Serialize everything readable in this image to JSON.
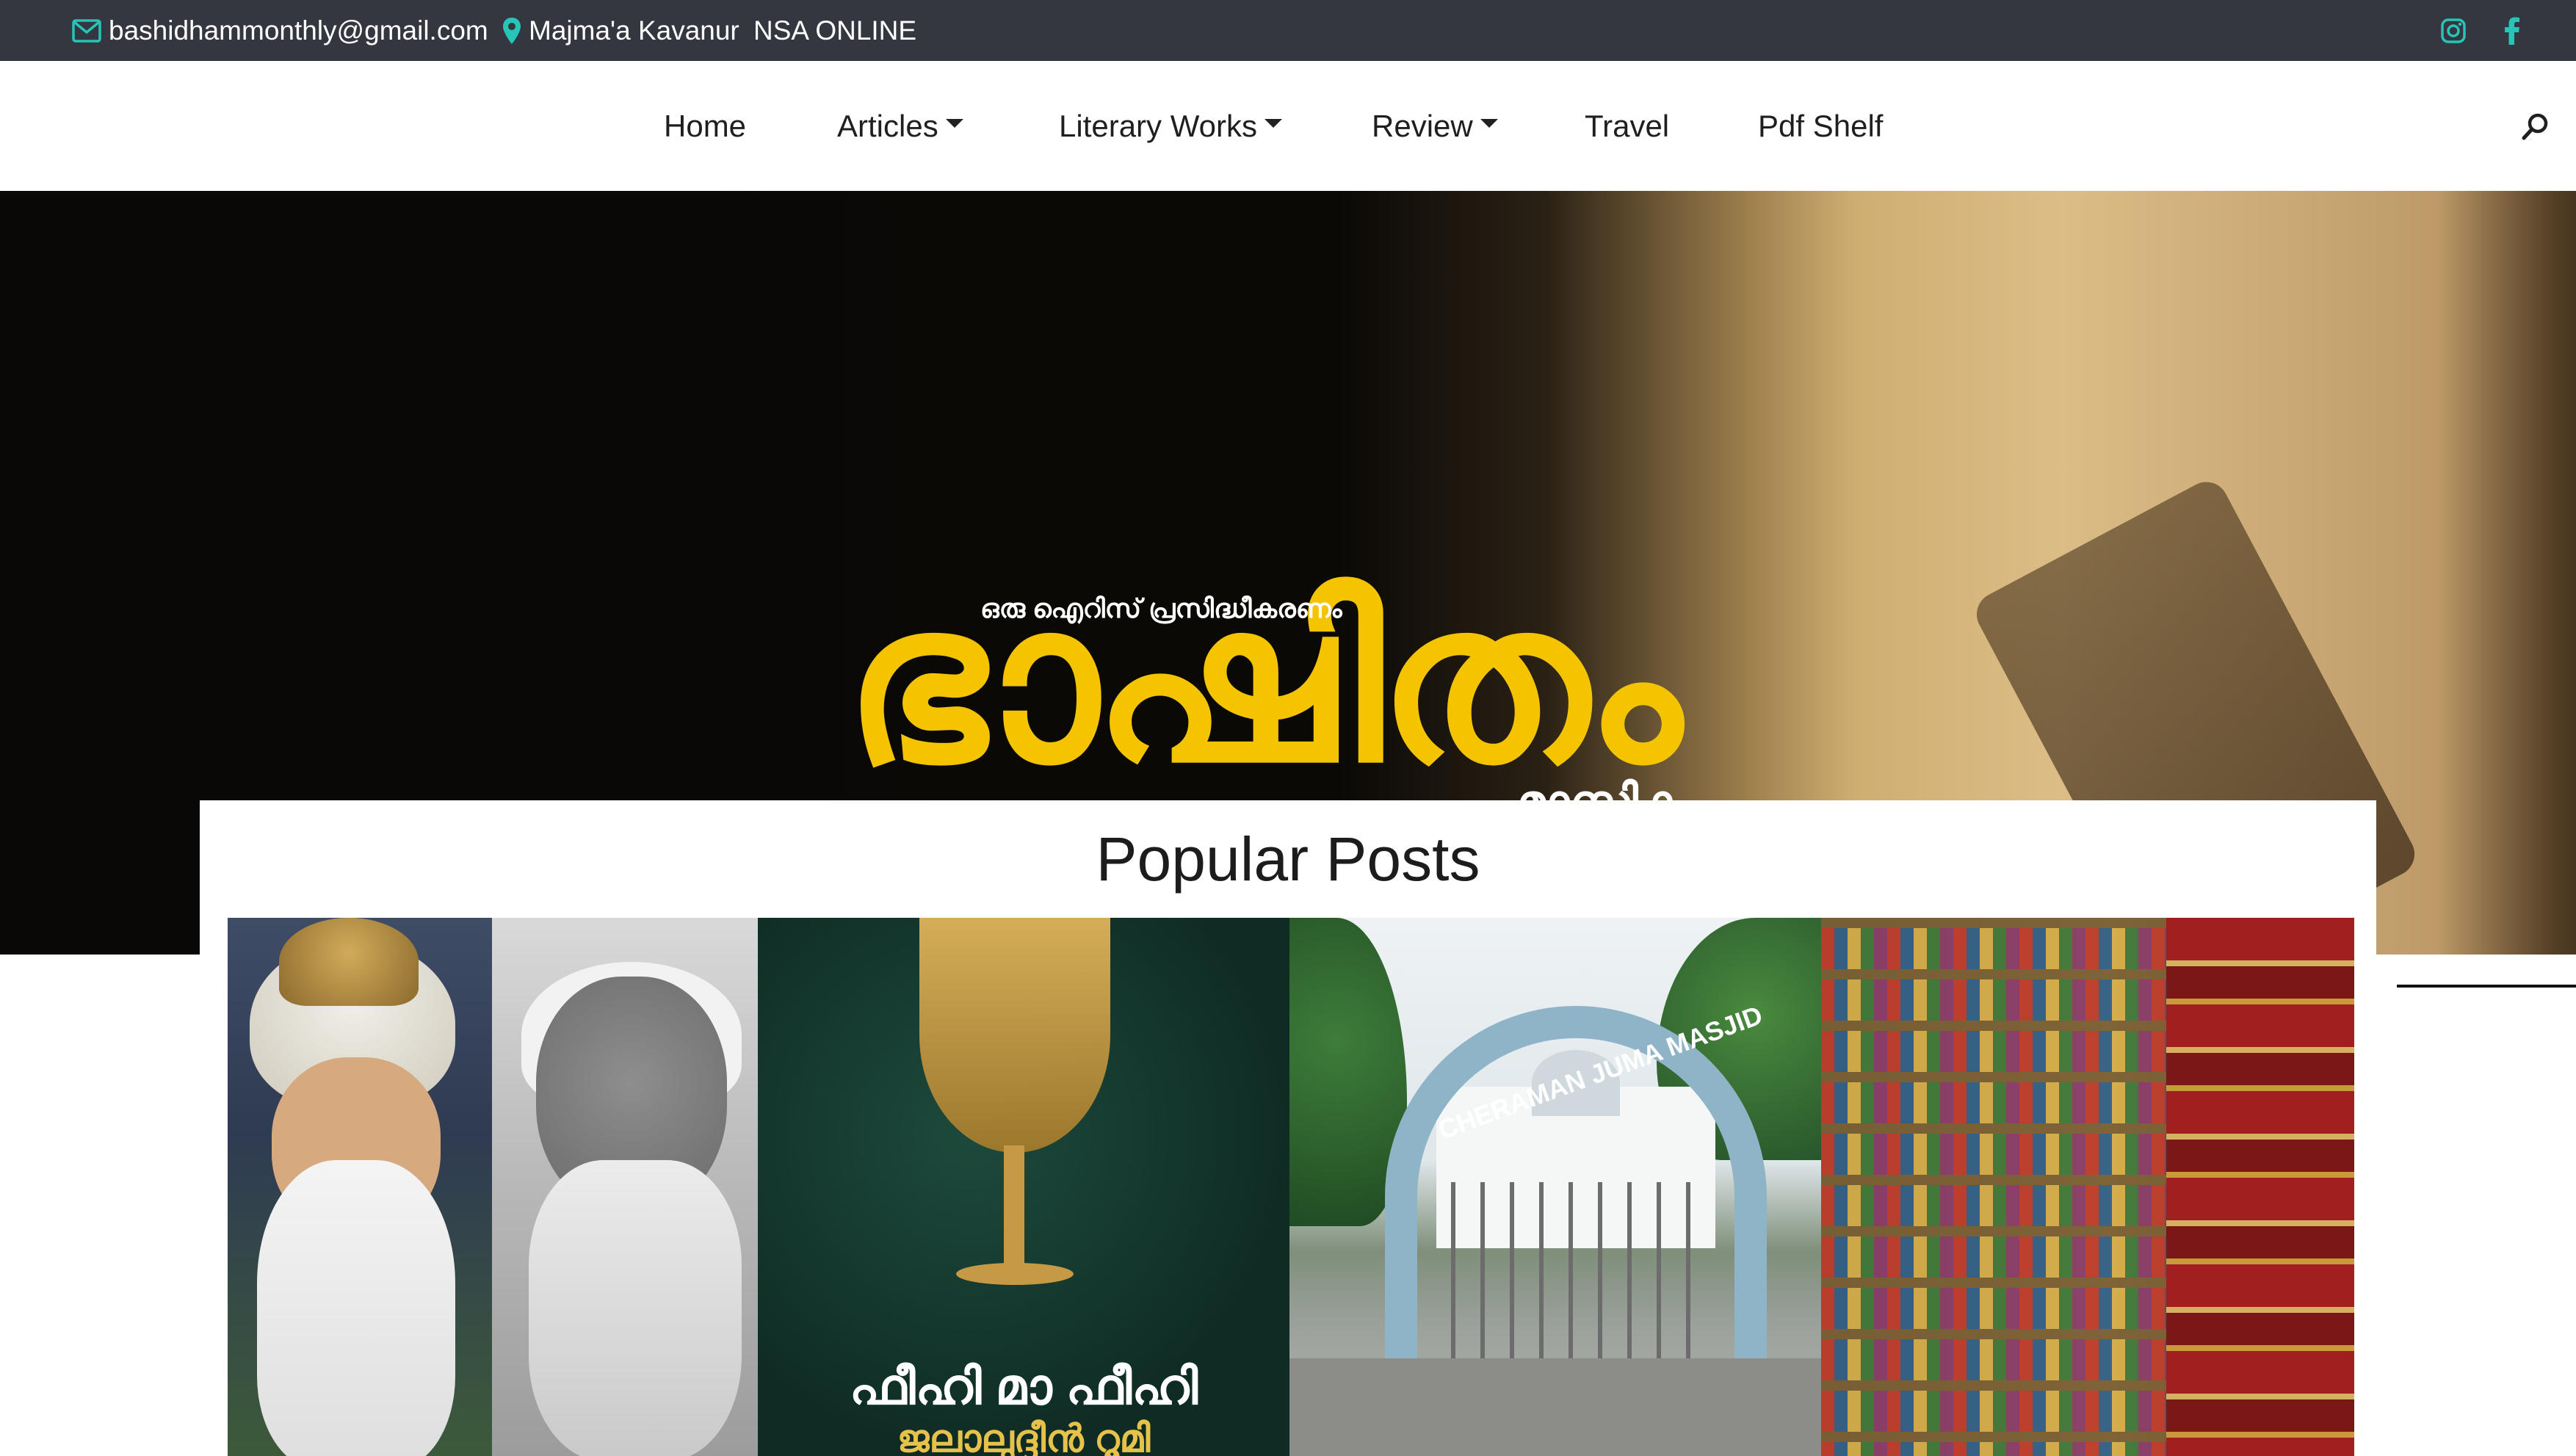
{
  "topbar": {
    "email": "bashidhammonthly@gmail.com",
    "location": "Majma'a Kavanur",
    "nsa": "NSA ONLINE",
    "icon_color": "#27c4b8"
  },
  "nav": {
    "items": [
      {
        "label": "Home",
        "dropdown": false
      },
      {
        "label": "Articles",
        "dropdown": true
      },
      {
        "label": "Literary Works",
        "dropdown": true
      },
      {
        "label": "Review",
        "dropdown": true
      },
      {
        "label": "Travel",
        "dropdown": false
      },
      {
        "label": "Pdf Shelf",
        "dropdown": false
      }
    ]
  },
  "hero": {
    "tagline": "ഒരു ഐറിസ് പ്രസിദ്ധീകരണം",
    "title": "ഭാഷിതം",
    "subtitle": "മാസിക",
    "title_color": "#f5c400"
  },
  "popular": {
    "heading": "Popular Posts",
    "cards": [
      {
        "image": "two portrait paintings"
      },
      {
        "image": "book cover",
        "text_main": "ഫീഹി മാ ഫീഹി",
        "text_author": "ജലാലുദ്ദീൻ റൂമി"
      },
      {
        "image": "mosque entrance arch",
        "arch_text": "CHERAMAN JUMA MASJID"
      },
      {
        "image": "bookshelves"
      }
    ]
  }
}
